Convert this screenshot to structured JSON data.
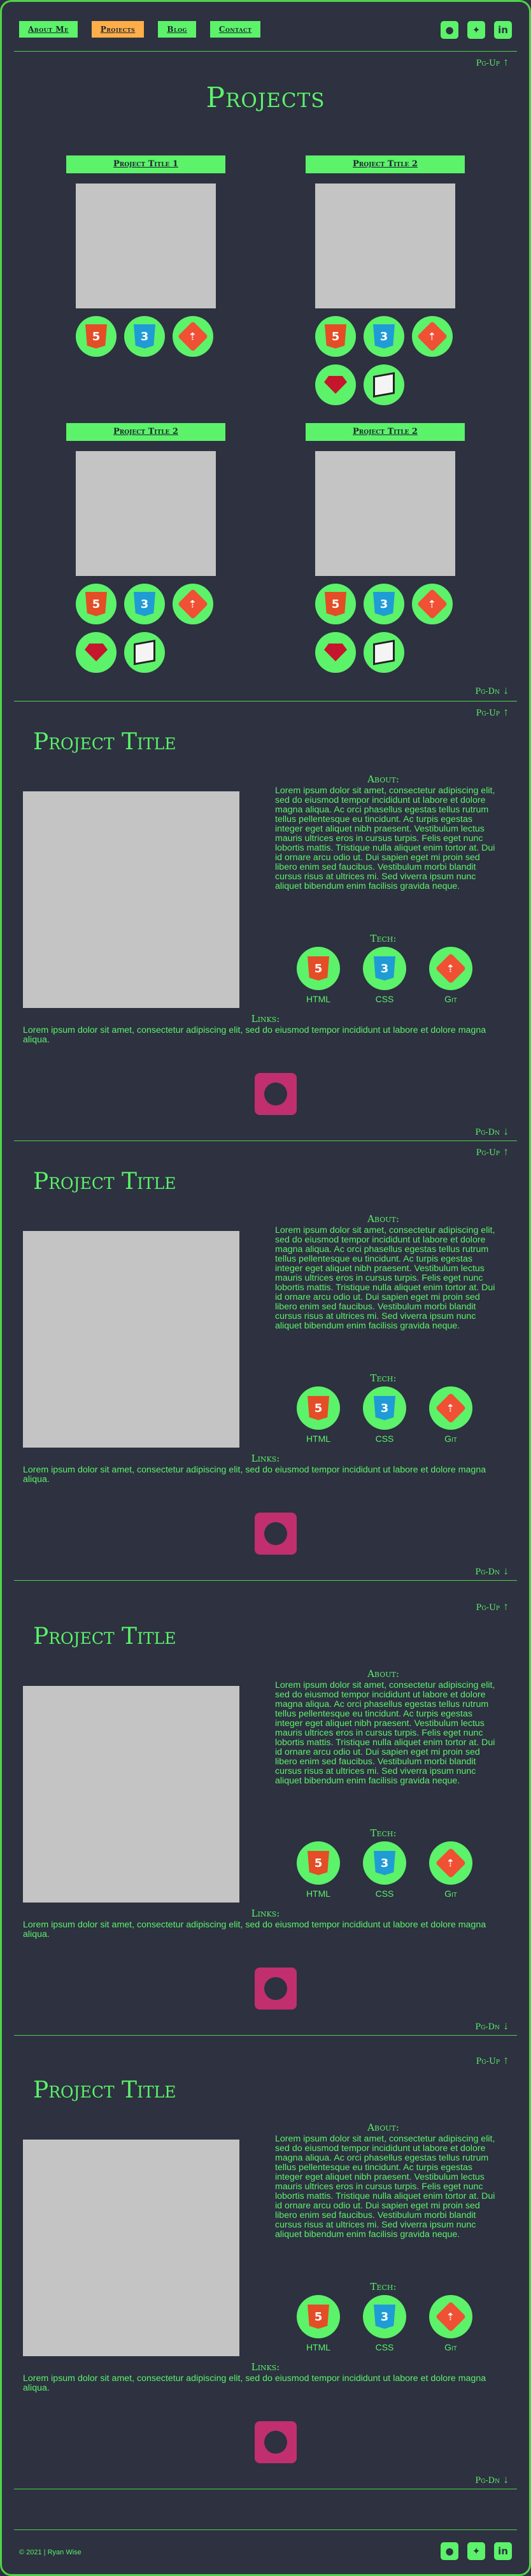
{
  "nav": {
    "about": "About Me",
    "projects": "Projects",
    "blog": "Blog",
    "contact": "Contact"
  },
  "social": {
    "github": "github-icon",
    "twitter": "twitter-icon",
    "linkedin": "linkedin-icon"
  },
  "pg_up": "Pg-Up ⇡",
  "pg_dn": "Pg-Dn ⇣",
  "page_title": "Projects",
  "cards": [
    {
      "title": "Project Title 1",
      "icons": [
        "html5",
        "css3",
        "git"
      ]
    },
    {
      "title": "Project Title 2",
      "icons": [
        "html5",
        "css3",
        "git",
        "ruby",
        "cube"
      ]
    },
    {
      "title": "Project Title 2",
      "icons": [
        "html5",
        "css3",
        "git",
        "ruby",
        "cube"
      ]
    },
    {
      "title": "Project Title 2",
      "icons": [
        "html5",
        "css3",
        "git",
        "ruby",
        "cube"
      ]
    }
  ],
  "project": {
    "title": "Project Title",
    "about_heading": "About:",
    "about_text": "Lorem ipsum dolor sit amet, consectetur adipiscing elit, sed do eiusmod tempor incididunt ut labore et dolore magna aliqua. Ac orci phasellus egestas tellus rutrum tellus pellentesque eu tincidunt. Ac turpis egestas integer eget aliquet nibh praesent. Vestibulum lectus mauris ultrices eros in cursus turpis. Felis eget nunc lobortis mattis. Tristique nulla aliquet enim tortor at. Dui id ornare arcu odio ut. Dui sapien eget mi proin sed libero enim sed faucibus. Vestibulum morbi blandit cursus risus at ultrices mi. Sed viverra ipsum nunc aliquet bibendum enim facilisis gravida neque.",
    "tech_heading": "Tech:",
    "tech": [
      "HTML",
      "CSS",
      "Git"
    ],
    "links_heading": "Links:",
    "links_text": "Lorem ipsum dolor sit amet, consectetur adipiscing elit, sed do eiusmod tempor incididunt ut labore et dolore magna aliqua."
  },
  "footer": "© 2021 | Ryan Wise",
  "colors": {
    "bg": "#2d3140",
    "accent": "#5cf26a",
    "active": "#ffae4a",
    "github_bg": "#c12f6e"
  }
}
